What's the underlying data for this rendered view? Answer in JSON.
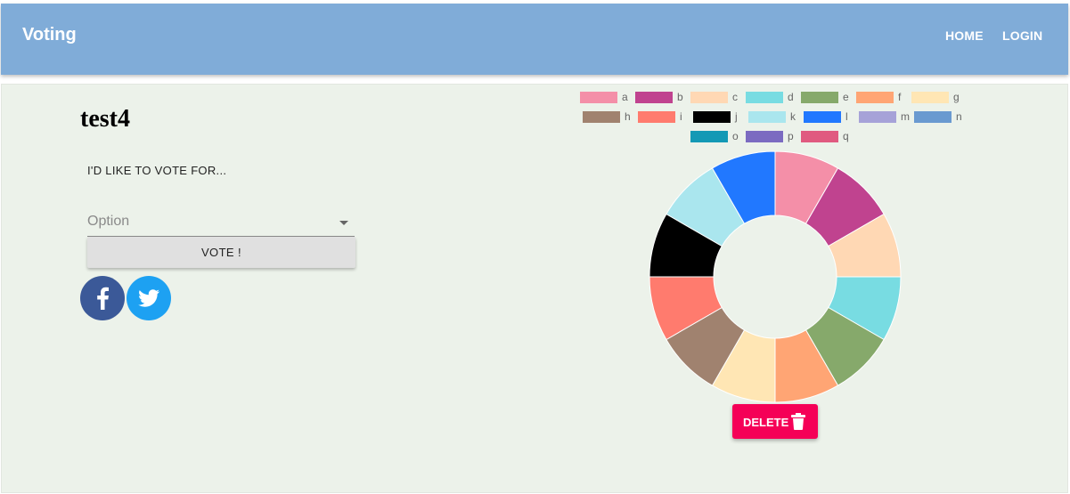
{
  "appbar": {
    "brand": "Voting",
    "nav": [
      {
        "label": "HOME"
      },
      {
        "label": "LOGIN"
      }
    ]
  },
  "poll": {
    "title": "test4",
    "prompt": "I'D LIKE TO VOTE FOR...",
    "select_placeholder": "Option",
    "vote_label": "VOTE !",
    "delete_label": "DELETE"
  },
  "share": [
    {
      "network": "facebook",
      "icon": "facebook-icon",
      "color": "#3b5998"
    },
    {
      "network": "twitter",
      "icon": "twitter-icon",
      "color": "#1da1f2"
    }
  ],
  "chart_data": {
    "type": "pie",
    "variant": "doughnut",
    "legend_position": "top",
    "categories": [
      "a",
      "b",
      "c",
      "d",
      "e",
      "f",
      "g",
      "h",
      "i",
      "j",
      "k",
      "l",
      "m",
      "n",
      "o",
      "p",
      "q"
    ],
    "colors": [
      "#f48fa8",
      "#c0438f",
      "#ffd8b4",
      "#78dce2",
      "#86a96b",
      "#ffa574",
      "#ffe6b4",
      "#a0826f",
      "#ff7b6e",
      "#000000",
      "#aae6ee",
      "#2178ff",
      "#a6a2d8",
      "#6a9ad0",
      "#1399b5",
      "#7b6bc1",
      "#e05a80"
    ],
    "values": [
      1,
      1,
      1,
      1,
      1,
      1,
      1,
      1,
      1,
      1,
      1,
      1,
      0,
      0,
      0,
      0,
      0
    ]
  }
}
